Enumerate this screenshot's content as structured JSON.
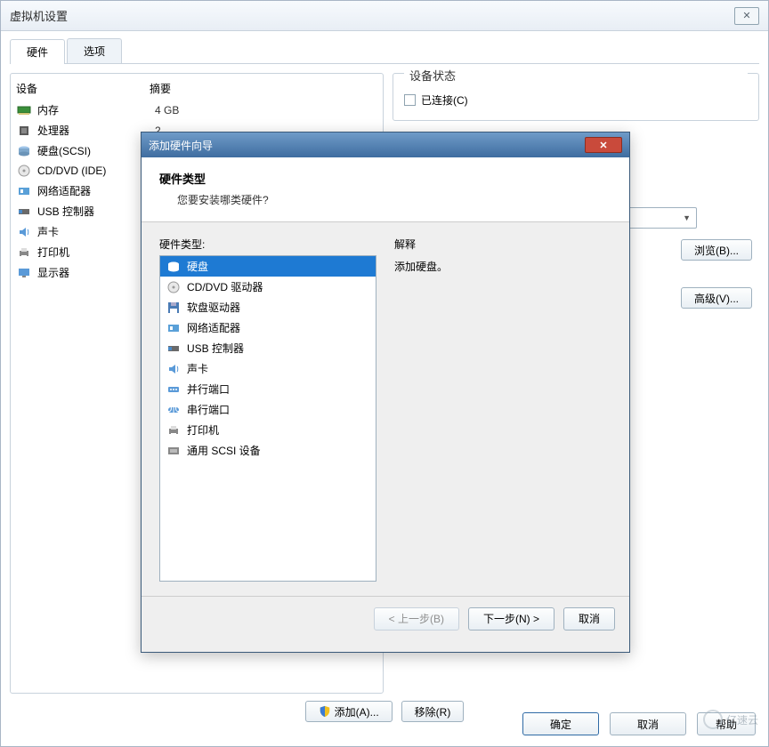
{
  "main": {
    "title": "虚拟机设置",
    "tabs": [
      "硬件",
      "选项"
    ],
    "headers": {
      "device": "设备",
      "summary": "摘要"
    },
    "devices": [
      {
        "name": "内存",
        "summary": "4 GB",
        "icon": "memory"
      },
      {
        "name": "处理器",
        "summary": "2",
        "icon": "cpu"
      },
      {
        "name": "硬盘(SCSI)",
        "summary": "",
        "icon": "disk"
      },
      {
        "name": "CD/DVD (IDE)",
        "summary": "",
        "icon": "cd"
      },
      {
        "name": "网络适配器",
        "summary": "",
        "icon": "nic"
      },
      {
        "name": "USB 控制器",
        "summary": "",
        "icon": "usb"
      },
      {
        "name": "声卡",
        "summary": "",
        "icon": "sound"
      },
      {
        "name": "打印机",
        "summary": "",
        "icon": "printer"
      },
      {
        "name": "显示器",
        "summary": "",
        "icon": "display"
      }
    ],
    "right": {
      "status_legend": "设备状态",
      "connected": "已连接(C)",
      "browse": "浏览(B)...",
      "advanced": "高级(V)..."
    },
    "buttons": {
      "add": "添加(A)...",
      "remove": "移除(R)",
      "ok": "确定",
      "cancel": "取消",
      "help": "帮助"
    }
  },
  "wizard": {
    "title": "添加硬件向导",
    "heading": "硬件类型",
    "subheading": "您要安装哪类硬件?",
    "list_label": "硬件类型:",
    "explain_label": "解释",
    "explain_text": "添加硬盘。",
    "items": [
      {
        "label": "硬盘",
        "icon": "disk",
        "selected": true
      },
      {
        "label": "CD/DVD 驱动器",
        "icon": "cd"
      },
      {
        "label": "软盘驱动器",
        "icon": "floppy"
      },
      {
        "label": "网络适配器",
        "icon": "nic"
      },
      {
        "label": "USB 控制器",
        "icon": "usb"
      },
      {
        "label": "声卡",
        "icon": "sound"
      },
      {
        "label": "并行端口",
        "icon": "parallel"
      },
      {
        "label": "串行端口",
        "icon": "serial"
      },
      {
        "label": "打印机",
        "icon": "printer"
      },
      {
        "label": "通用 SCSI 设备",
        "icon": "scsi"
      }
    ],
    "buttons": {
      "back": "< 上一步(B)",
      "next": "下一步(N) >",
      "cancel": "取消"
    }
  },
  "watermark": "亿速云"
}
